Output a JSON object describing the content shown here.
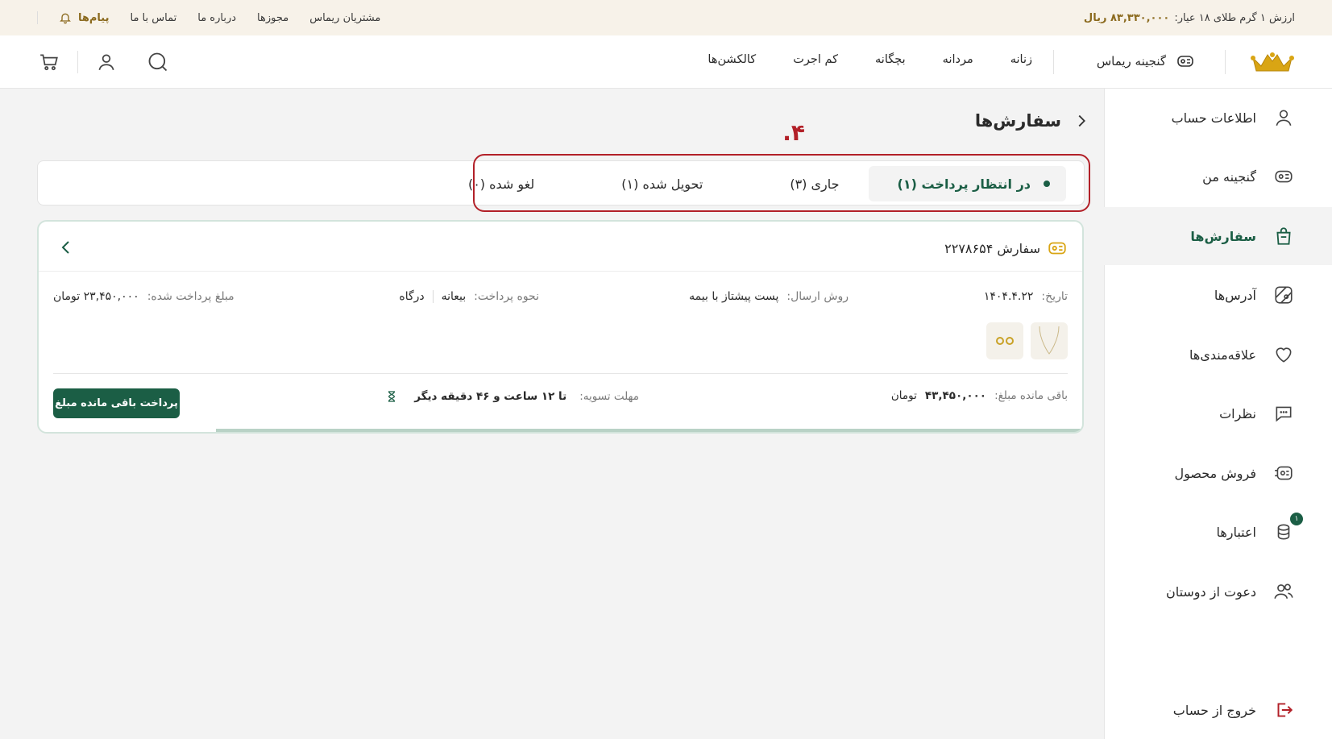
{
  "topbar": {
    "gold_label": "ارزش ۱ گرم طلای ۱۸ عیار:",
    "gold_value": "۸۳,۳۳۰,۰۰۰ ریال",
    "links": [
      "مشتریان ریماس",
      "مجوزها",
      "درباره ما",
      "تماس با ما"
    ],
    "messages": "پیام‌ها"
  },
  "header": {
    "my_treasure": "گنجینه ریماس",
    "nav": [
      "زنانه",
      "مردانه",
      "بچگانه",
      "کم اجرت",
      "کالکشن‌ها"
    ]
  },
  "sidebar": {
    "items": [
      {
        "label": "اطلاعات حساب",
        "icon": "user-icon"
      },
      {
        "label": "گنجینه من",
        "icon": "treasure-icon"
      },
      {
        "label": "سفارش‌ها",
        "icon": "bag-icon"
      },
      {
        "label": "آدرس‌ها",
        "icon": "map-icon"
      },
      {
        "label": "علاقه‌مندی‌ها",
        "icon": "heart-icon"
      },
      {
        "label": "نظرات",
        "icon": "comment-icon"
      },
      {
        "label": "فروش محصول",
        "icon": "sell-icon"
      },
      {
        "label": "اعتبارها",
        "icon": "coins-icon",
        "badge": "۱"
      },
      {
        "label": "دعوت از دوستان",
        "icon": "users-icon"
      }
    ],
    "logout": "خروج از حساب"
  },
  "page": {
    "title": "سفارش‌ها",
    "annotation": "۴."
  },
  "tabs": [
    {
      "label": "در انتظار پرداخت (۱)",
      "active": true
    },
    {
      "label": "جاری (۳)",
      "active": false
    },
    {
      "label": "تحویل شده (۱)",
      "active": false
    },
    {
      "label": "لغو شده (۰)",
      "active": false
    }
  ],
  "order": {
    "title": "سفارش ۲۲۷۸۶۵۴",
    "date_label": "تاریخ:",
    "date": "۱۴۰۴.۴.۲۲",
    "shipping_label": "روش ارسال:",
    "shipping": "پست پیشتاز با بیمه",
    "payment_label": "نحوه پرداخت:",
    "payment_method_1": "بیعانه",
    "payment_method_2": "درگاه",
    "paid_label": "مبلغ پرداخت شده:",
    "paid": "۲۳,۴۵۰,۰۰۰ تومان",
    "remaining_label": "باقی مانده مبلغ:",
    "remaining_value": "۴۳,۴۵۰,۰۰۰",
    "remaining_unit": "تومان",
    "deadline_label": "مهلت تسویه:",
    "deadline": "تا ۱۲ ساعت و ۴۶ دقیقه دیگر",
    "pay_button": "پرداخت باقی مانده مبلغ",
    "progress": 0.83
  },
  "colors": {
    "accent": "#1b5e45",
    "gold": "#8b6a1e",
    "highlight": "#b22028"
  }
}
